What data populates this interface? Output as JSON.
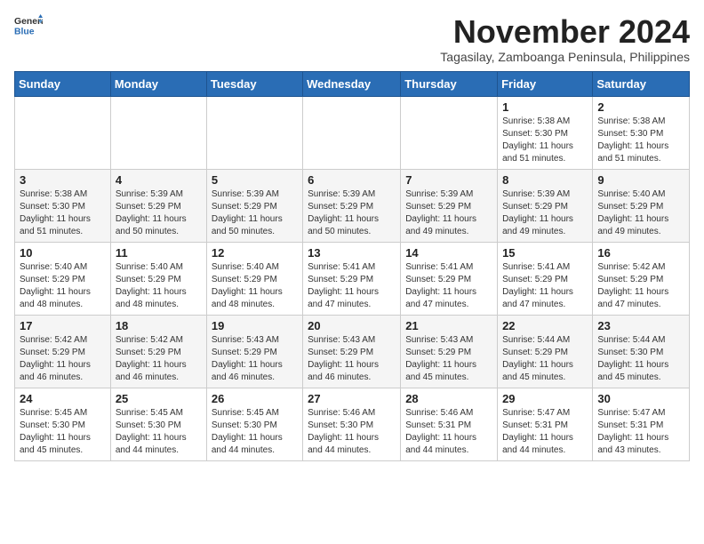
{
  "header": {
    "logo_general": "General",
    "logo_blue": "Blue",
    "month_title": "November 2024",
    "subtitle": "Tagasilay, Zamboanga Peninsula, Philippines"
  },
  "weekdays": [
    "Sunday",
    "Monday",
    "Tuesday",
    "Wednesday",
    "Thursday",
    "Friday",
    "Saturday"
  ],
  "weeks": [
    [
      {
        "day": "",
        "info": ""
      },
      {
        "day": "",
        "info": ""
      },
      {
        "day": "",
        "info": ""
      },
      {
        "day": "",
        "info": ""
      },
      {
        "day": "",
        "info": ""
      },
      {
        "day": "1",
        "info": "Sunrise: 5:38 AM\nSunset: 5:30 PM\nDaylight: 11 hours and 51 minutes."
      },
      {
        "day": "2",
        "info": "Sunrise: 5:38 AM\nSunset: 5:30 PM\nDaylight: 11 hours and 51 minutes."
      }
    ],
    [
      {
        "day": "3",
        "info": "Sunrise: 5:38 AM\nSunset: 5:30 PM\nDaylight: 11 hours and 51 minutes."
      },
      {
        "day": "4",
        "info": "Sunrise: 5:39 AM\nSunset: 5:29 PM\nDaylight: 11 hours and 50 minutes."
      },
      {
        "day": "5",
        "info": "Sunrise: 5:39 AM\nSunset: 5:29 PM\nDaylight: 11 hours and 50 minutes."
      },
      {
        "day": "6",
        "info": "Sunrise: 5:39 AM\nSunset: 5:29 PM\nDaylight: 11 hours and 50 minutes."
      },
      {
        "day": "7",
        "info": "Sunrise: 5:39 AM\nSunset: 5:29 PM\nDaylight: 11 hours and 49 minutes."
      },
      {
        "day": "8",
        "info": "Sunrise: 5:39 AM\nSunset: 5:29 PM\nDaylight: 11 hours and 49 minutes."
      },
      {
        "day": "9",
        "info": "Sunrise: 5:40 AM\nSunset: 5:29 PM\nDaylight: 11 hours and 49 minutes."
      }
    ],
    [
      {
        "day": "10",
        "info": "Sunrise: 5:40 AM\nSunset: 5:29 PM\nDaylight: 11 hours and 48 minutes."
      },
      {
        "day": "11",
        "info": "Sunrise: 5:40 AM\nSunset: 5:29 PM\nDaylight: 11 hours and 48 minutes."
      },
      {
        "day": "12",
        "info": "Sunrise: 5:40 AM\nSunset: 5:29 PM\nDaylight: 11 hours and 48 minutes."
      },
      {
        "day": "13",
        "info": "Sunrise: 5:41 AM\nSunset: 5:29 PM\nDaylight: 11 hours and 47 minutes."
      },
      {
        "day": "14",
        "info": "Sunrise: 5:41 AM\nSunset: 5:29 PM\nDaylight: 11 hours and 47 minutes."
      },
      {
        "day": "15",
        "info": "Sunrise: 5:41 AM\nSunset: 5:29 PM\nDaylight: 11 hours and 47 minutes."
      },
      {
        "day": "16",
        "info": "Sunrise: 5:42 AM\nSunset: 5:29 PM\nDaylight: 11 hours and 47 minutes."
      }
    ],
    [
      {
        "day": "17",
        "info": "Sunrise: 5:42 AM\nSunset: 5:29 PM\nDaylight: 11 hours and 46 minutes."
      },
      {
        "day": "18",
        "info": "Sunrise: 5:42 AM\nSunset: 5:29 PM\nDaylight: 11 hours and 46 minutes."
      },
      {
        "day": "19",
        "info": "Sunrise: 5:43 AM\nSunset: 5:29 PM\nDaylight: 11 hours and 46 minutes."
      },
      {
        "day": "20",
        "info": "Sunrise: 5:43 AM\nSunset: 5:29 PM\nDaylight: 11 hours and 46 minutes."
      },
      {
        "day": "21",
        "info": "Sunrise: 5:43 AM\nSunset: 5:29 PM\nDaylight: 11 hours and 45 minutes."
      },
      {
        "day": "22",
        "info": "Sunrise: 5:44 AM\nSunset: 5:29 PM\nDaylight: 11 hours and 45 minutes."
      },
      {
        "day": "23",
        "info": "Sunrise: 5:44 AM\nSunset: 5:30 PM\nDaylight: 11 hours and 45 minutes."
      }
    ],
    [
      {
        "day": "24",
        "info": "Sunrise: 5:45 AM\nSunset: 5:30 PM\nDaylight: 11 hours and 45 minutes."
      },
      {
        "day": "25",
        "info": "Sunrise: 5:45 AM\nSunset: 5:30 PM\nDaylight: 11 hours and 44 minutes."
      },
      {
        "day": "26",
        "info": "Sunrise: 5:45 AM\nSunset: 5:30 PM\nDaylight: 11 hours and 44 minutes."
      },
      {
        "day": "27",
        "info": "Sunrise: 5:46 AM\nSunset: 5:30 PM\nDaylight: 11 hours and 44 minutes."
      },
      {
        "day": "28",
        "info": "Sunrise: 5:46 AM\nSunset: 5:31 PM\nDaylight: 11 hours and 44 minutes."
      },
      {
        "day": "29",
        "info": "Sunrise: 5:47 AM\nSunset: 5:31 PM\nDaylight: 11 hours and 44 minutes."
      },
      {
        "day": "30",
        "info": "Sunrise: 5:47 AM\nSunset: 5:31 PM\nDaylight: 11 hours and 43 minutes."
      }
    ]
  ]
}
